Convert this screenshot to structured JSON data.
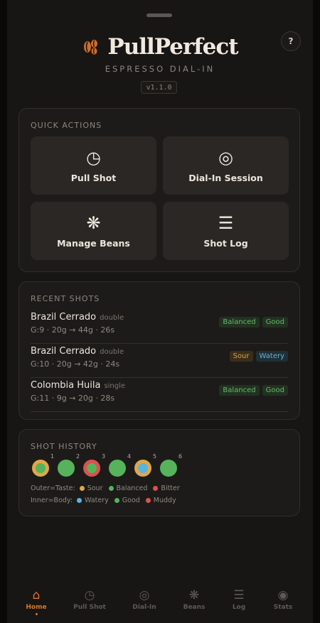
{
  "app": {
    "title": "PullPerfect",
    "subtitle": "ESPRESSO DIAL-IN",
    "version": "v1.1.0",
    "help_label": "?",
    "accent": "#d9762f"
  },
  "quick_actions": {
    "title": "QUICK ACTIONS",
    "items": [
      {
        "label": "Pull Shot",
        "icon": "clock-icon",
        "glyph": "◷"
      },
      {
        "label": "Dial-In Session",
        "icon": "target-icon",
        "glyph": "◎"
      },
      {
        "label": "Manage Beans",
        "icon": "asterisk-icon",
        "glyph": "❋"
      },
      {
        "label": "Shot Log",
        "icon": "list-icon",
        "glyph": "☰"
      }
    ]
  },
  "recent_shots": {
    "title": "RECENT SHOTS",
    "items": [
      {
        "name": "Brazil Cerrado",
        "type": "double",
        "meta": "G:9 · 20g → 44g · 26s",
        "tags": [
          {
            "label": "Balanced",
            "tone": "green"
          },
          {
            "label": "Good",
            "tone": "green"
          }
        ]
      },
      {
        "name": "Brazil Cerrado",
        "type": "double",
        "meta": "G:10 · 20g → 42g · 24s",
        "tags": [
          {
            "label": "Sour",
            "tone": "amber"
          },
          {
            "label": "Watery",
            "tone": "blue"
          }
        ]
      },
      {
        "name": "Colombia Huila",
        "type": "single",
        "meta": "G:11 · 9g → 20g · 28s",
        "tags": [
          {
            "label": "Balanced",
            "tone": "green"
          },
          {
            "label": "Good",
            "tone": "green"
          }
        ]
      }
    ]
  },
  "shot_history": {
    "title": "SHOT HISTORY",
    "dots": [
      {
        "num": "1",
        "taste": "Sour",
        "body": "Good"
      },
      {
        "num": "2",
        "taste": "Balanced",
        "body": "Good"
      },
      {
        "num": "3",
        "taste": "Bitter",
        "body": "Good"
      },
      {
        "num": "4",
        "taste": "Balanced",
        "body": "Good"
      },
      {
        "num": "5",
        "taste": "Sour",
        "body": "Watery"
      },
      {
        "num": "6",
        "taste": "Balanced",
        "body": "Good"
      }
    ],
    "legend": {
      "outer_label": "Outer=Taste:",
      "outer": [
        {
          "label": "Sour",
          "color": "#e0a748"
        },
        {
          "label": "Balanced",
          "color": "#56b35c"
        },
        {
          "label": "Bitter",
          "color": "#d9534f"
        }
      ],
      "inner_label": "Inner=Body:",
      "inner": [
        {
          "label": "Watery",
          "color": "#5ab4dc"
        },
        {
          "label": "Good",
          "color": "#56b35c"
        },
        {
          "label": "Muddy",
          "color": "#d9534f"
        }
      ]
    }
  },
  "nav": {
    "items": [
      {
        "label": "Home",
        "icon": "home-icon",
        "glyph": "⌂",
        "active": true
      },
      {
        "label": "Pull Shot",
        "icon": "clock-icon",
        "glyph": "◷",
        "active": false
      },
      {
        "label": "Dial-In",
        "icon": "target-icon",
        "glyph": "◎",
        "active": false
      },
      {
        "label": "Beans",
        "icon": "asterisk-icon",
        "glyph": "❋",
        "active": false
      },
      {
        "label": "Log",
        "icon": "list-icon",
        "glyph": "☰",
        "active": false
      },
      {
        "label": "Stats",
        "icon": "stats-icon",
        "glyph": "◉",
        "active": false
      }
    ]
  }
}
